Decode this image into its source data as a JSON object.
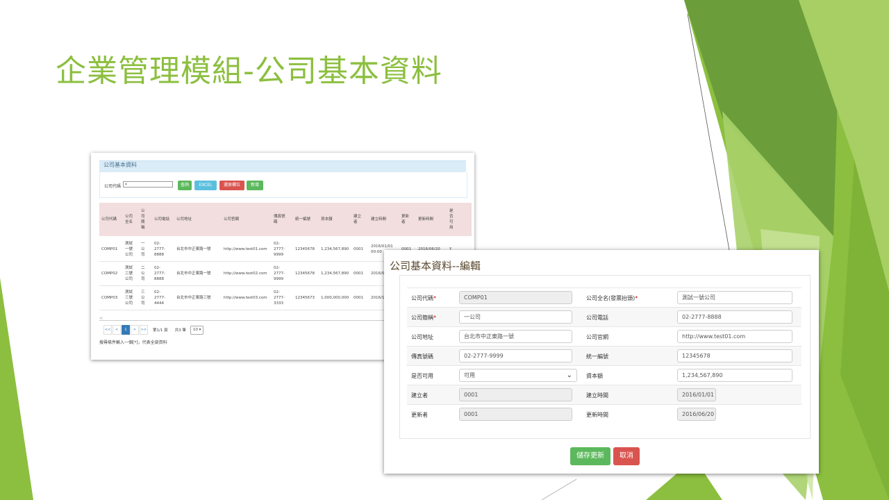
{
  "slide": {
    "title": "企業管理模組-公司基本資料"
  },
  "colors": {
    "green_accent": "#8cbf3f",
    "btn_green": "#5cb85c",
    "btn_blue": "#5bc0de",
    "btn_red": "#d9534f",
    "header_pink": "#f2dede"
  },
  "list_screen": {
    "panel_title": "公司基本資料",
    "search_label": "公司代碼",
    "search_value": "*",
    "buttons": {
      "query": "查詢",
      "excel": "EXCEL",
      "clear": "還原欄位",
      "add": "新增"
    },
    "columns": [
      "公司代碼",
      "公司全名",
      "公司簡稱",
      "公司電話",
      "公司地址",
      "公司官網",
      "傳真號碼",
      "統一編號",
      "資本額",
      "建立者",
      "建立時間",
      "更新者",
      "更新時間",
      "是否可用"
    ],
    "rows": [
      [
        "COMP01",
        "測試一號公司",
        "一公司",
        "02-2777-8888",
        "台北市中正東路一號",
        "http://www.test01.com",
        "02-2777-9999",
        "12345678",
        "1,234,567,890",
        "0001",
        "2016/01/01 00:00",
        "0001",
        "2016/06/20",
        "Y"
      ],
      [
        "COMP02",
        "測試二號公司",
        "二公司",
        "02-2777-8888",
        "台北市中正東路一號",
        "http://www.test02.com",
        "02-2777-9999",
        "12345678",
        "1,234,567,890",
        "0001",
        "2016/0 00:00",
        "",
        "",
        ""
      ],
      [
        "COMP03",
        "測試三號公司",
        "三公司",
        "02-2777-4444",
        "台北市中正東路三號",
        "http://www.test03.com",
        "02-2777-3333",
        "12345673",
        "1,000,000,000",
        "0001",
        "2016/1 17:53",
        "",
        "",
        ""
      ]
    ],
    "pager": {
      "first": "<<",
      "prev": "<",
      "current": "1",
      "next": ">",
      "last": ">>",
      "page_info": "第1/1 頁",
      "total": "共3 筆",
      "page_size": "10"
    },
    "note": "搜尋條件輸入一個[*]，代表全部資料"
  },
  "edit_screen": {
    "title": "公司基本資料--編輯",
    "fields": [
      {
        "label": "公司代碼",
        "required": "*",
        "value": "COMP01",
        "readonly": true
      },
      {
        "label": "公司全名(發票抬頭)",
        "required": "*",
        "value": "測試一號公司",
        "readonly": false
      },
      {
        "label": "公司簡稱",
        "required": "*",
        "value": "一公司",
        "readonly": false
      },
      {
        "label": "公司電話",
        "required": "",
        "value": "02-2777-8888",
        "readonly": false
      },
      {
        "label": "公司地址",
        "required": "",
        "value": "台北市中正東路一號",
        "readonly": false
      },
      {
        "label": "公司官網",
        "required": "",
        "value": "http://www.test01.com",
        "readonly": false
      },
      {
        "label": "傳真號碼",
        "required": "",
        "value": "02-2777-9999",
        "readonly": false
      },
      {
        "label": "統一編號",
        "required": "",
        "value": "12345678",
        "readonly": false
      },
      {
        "label": "是否可用",
        "required": "",
        "value": "可用",
        "readonly": false
      },
      {
        "label": "資本額",
        "required": "",
        "value": "1,234,567,890",
        "readonly": false
      },
      {
        "label": "建立者",
        "required": "",
        "value": "0001",
        "readonly": true
      },
      {
        "label": "建立時間",
        "required": "",
        "value": "2016/01/01",
        "readonly": true
      },
      {
        "label": "更新者",
        "required": "",
        "value": "0001",
        "readonly": true
      },
      {
        "label": "更新時間",
        "required": "",
        "value": "2016/06/20",
        "readonly": true
      }
    ],
    "buttons": {
      "save": "儲存更新",
      "cancel": "取消"
    }
  }
}
